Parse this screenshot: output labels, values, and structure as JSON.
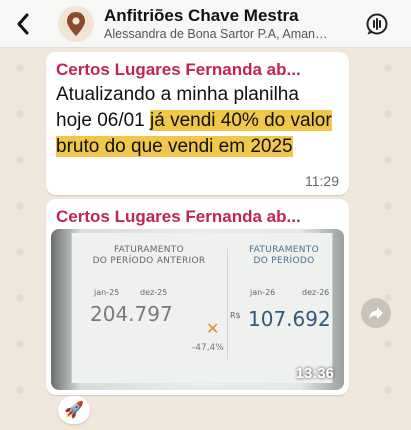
{
  "header": {
    "title": "Anfitriões Chave Mestra",
    "subtitle": "Alessandra de Bona Sartor P.A, Amanda...",
    "avatar_icon": "map-pin-icon",
    "back_icon": "chevron-left-icon",
    "call_icon": "voice-call-icon"
  },
  "messages": [
    {
      "sender": "Certos Lugares Fernanda ab...",
      "text_plain": "Atualizando a minha planilha hoje 06/01 ",
      "text_highlight": "já vendi 40% do valor bruto do que vendi em 2025",
      "time": "11:29"
    },
    {
      "sender": "Certos Lugares Fernanda ab...",
      "video": {
        "left_title_1": "FATURAMENTO",
        "left_title_2": "DO PERÍODO ANTERIOR",
        "left_from": "jan-25",
        "left_to": "dez-25",
        "left_value": "204.797",
        "currency": "R$",
        "right_title_1": "FATURAMENTO",
        "right_title_2": "DO PERÍODO",
        "right_from": "jan-26",
        "right_to": "dez-26",
        "right_value": "107.692",
        "change": "-47,4%",
        "duration": "13:36"
      },
      "reaction": "🚀"
    }
  ],
  "colors": {
    "sender": "#c2264e",
    "highlight": "#f0c74b",
    "background": "#efe7dc"
  }
}
